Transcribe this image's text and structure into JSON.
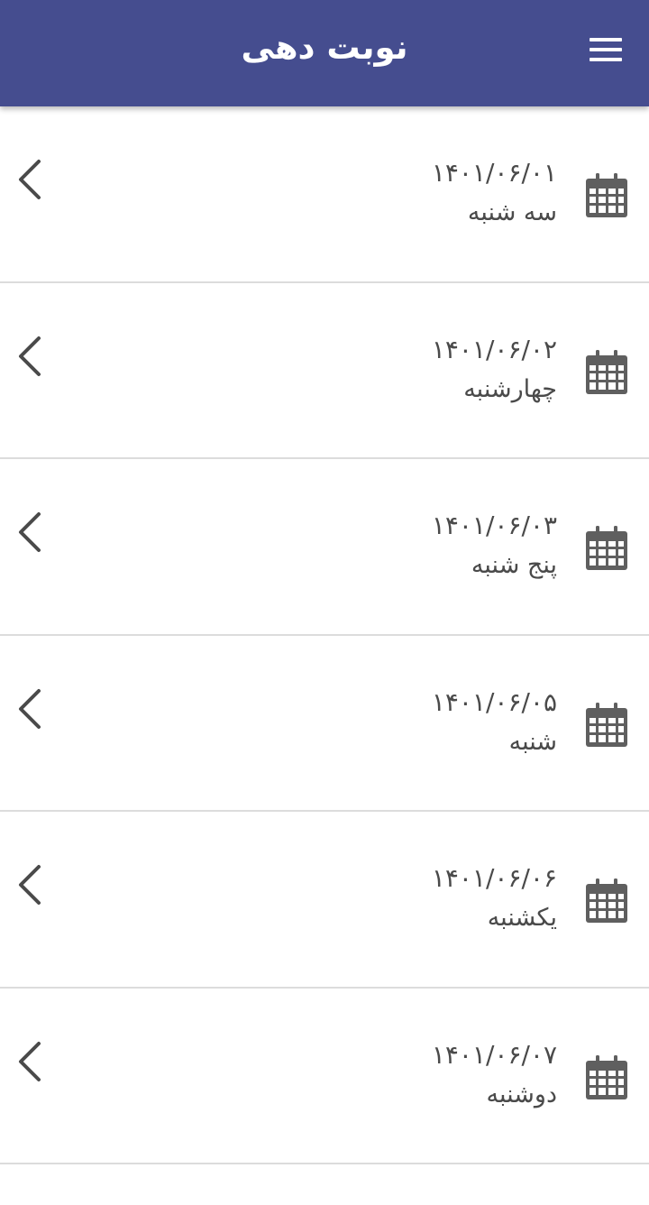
{
  "header": {
    "title": "نوبت دهی",
    "menu_icon": "hamburger-menu-icon",
    "background_color": "#454d8f"
  },
  "list": {
    "items": [
      {
        "date": "۱۴۰۱/۰۶/۰۱",
        "day": "سه شنبه",
        "icon": "calendar-icon",
        "arrow": "chevron-left-icon"
      },
      {
        "date": "۱۴۰۱/۰۶/۰۲",
        "day": "چهارشنبه",
        "icon": "calendar-icon",
        "arrow": "chevron-left-icon"
      },
      {
        "date": "۱۴۰۱/۰۶/۰۳",
        "day": "پنج شنبه",
        "icon": "calendar-icon",
        "arrow": "chevron-left-icon"
      },
      {
        "date": "۱۴۰۱/۰۶/۰۵",
        "day": "شنبه",
        "icon": "calendar-icon",
        "arrow": "chevron-left-icon"
      },
      {
        "date": "۱۴۰۱/۰۶/۰۶",
        "day": "یکشنبه",
        "icon": "calendar-icon",
        "arrow": "chevron-left-icon"
      },
      {
        "date": "۱۴۰۱/۰۶/۰۷",
        "day": "دوشنبه",
        "icon": "calendar-icon",
        "arrow": "chevron-left-icon"
      }
    ]
  },
  "colors": {
    "text": "#4a4a4a",
    "icon": "#5f5f5f",
    "divider": "#dcdcdc"
  }
}
